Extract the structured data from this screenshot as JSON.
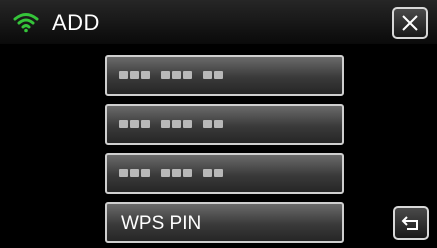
{
  "header": {
    "title": "ADD",
    "wifi_icon": "wifi-icon",
    "wifi_color": "#35c43a",
    "close_icon": "close-icon"
  },
  "network_list": {
    "items": [
      {
        "label": "",
        "masked": true
      },
      {
        "label": "",
        "masked": true
      },
      {
        "label": "",
        "masked": true
      },
      {
        "label": "WPS PIN",
        "masked": false
      }
    ]
  },
  "footer": {
    "back_icon": "return-arrow-icon"
  }
}
